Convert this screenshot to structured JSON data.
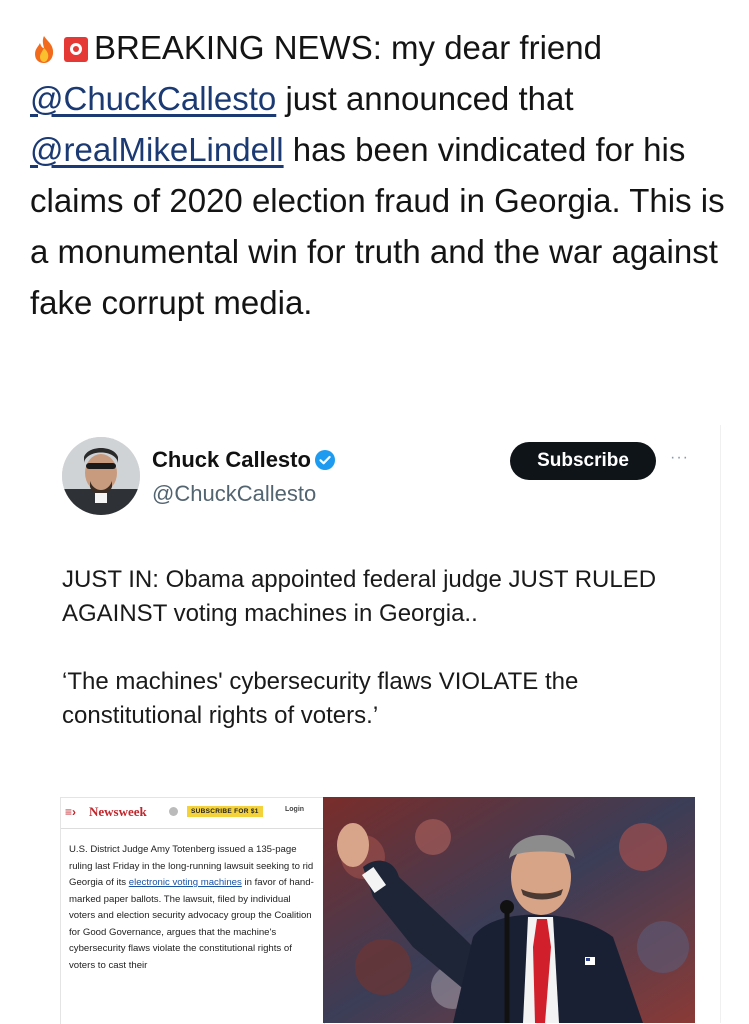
{
  "post": {
    "prefix": "BREAKING NEWS: my dear friend",
    "mention1": "@ChuckCallesto",
    "after1": "just announced that",
    "mention2": "@realMikeLindell",
    "after2": "has been vindicated for his claims of 2020 election fraud in Georgia. This is a monumental win for truth and the war against fake corrupt media.",
    "emojis": [
      "fire-icon",
      "siren-icon"
    ]
  },
  "tweet": {
    "name": "Chuck Callesto",
    "handle": "@ChuckCallesto",
    "subscribe_label": "Subscribe",
    "more_label": "···",
    "text1": "JUST IN: Obama appointed federal judge JUST RULED AGAINST voting machines in Georgia..",
    "text2": "‘The machines' cybersecurity flaws VIOLATE the constitutional rights of voters.’",
    "verified_color": "#1d9bf0"
  },
  "article": {
    "logo": "Newsweek",
    "menu": "≡›",
    "subscribe_label": "SUBSCRIBE FOR $1",
    "login_label": "Login",
    "body_before": "U.S. District Judge Amy Totenberg issued a 135-page ruling last Friday in the long-running lawsuit seeking to rid Georgia of its",
    "body_link": "electronic voting machines",
    "body_after": "in favor of hand-marked paper ballots. The lawsuit, filed by individual voters and election security advocacy group the Coalition for Good Governance, argues that the machine's cybersecurity flaws violate the constitutional rights of voters to cast their"
  }
}
